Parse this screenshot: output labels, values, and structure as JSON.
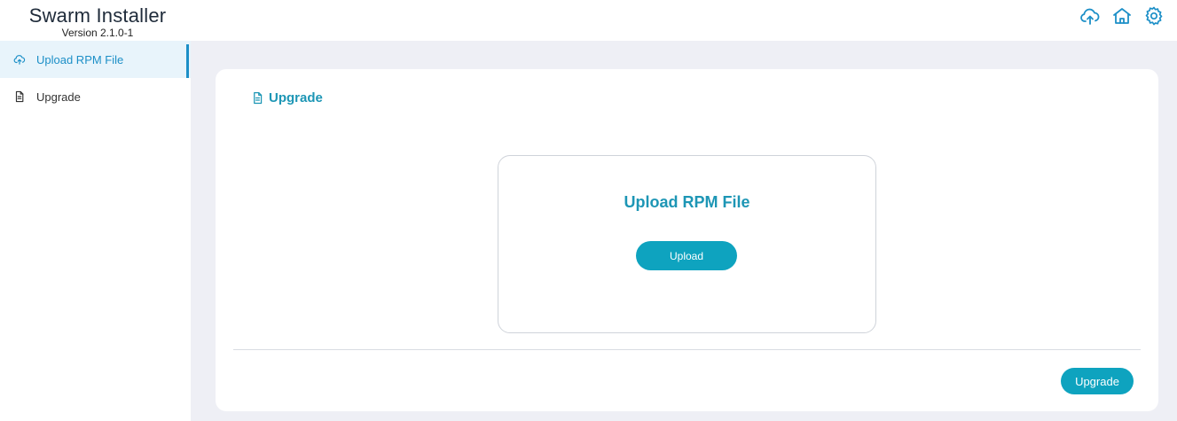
{
  "app": {
    "title": "Swarm Installer",
    "version": "Version 2.1.0-1"
  },
  "header": {
    "icons": [
      "cloud-upload-icon",
      "home-icon",
      "gear-icon"
    ]
  },
  "sidebar": {
    "items": [
      {
        "label": "Upload RPM File",
        "icon": "cloud-upload-icon",
        "active": true
      },
      {
        "label": "Upgrade",
        "icon": "document-icon",
        "active": false
      }
    ]
  },
  "main": {
    "card_title": "Upgrade",
    "upload_heading": "Upload RPM File",
    "upload_button": "Upload",
    "upgrade_button": "Upgrade"
  },
  "colors": {
    "accent": "#1d96b5",
    "button": "#0ea3bf",
    "sidebar_active_bg": "#e8f4fb",
    "main_bg": "#eeeff5"
  }
}
